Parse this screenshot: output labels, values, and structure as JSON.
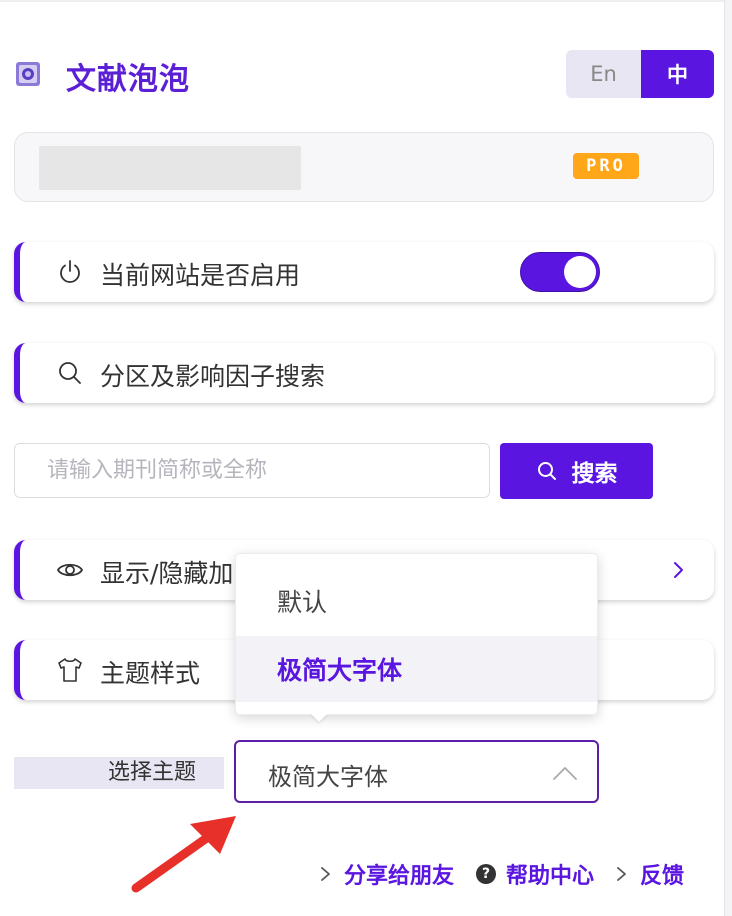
{
  "header": {
    "brand": "文献泡泡",
    "lang_en": "En",
    "lang_zh": "中"
  },
  "account": {
    "badge": "PRO"
  },
  "cards": {
    "site_toggle_label": "当前网站是否启用",
    "site_toggle_on": true,
    "search_section_label": "分区及影响因子搜索",
    "show_hide_label": "显示/隐藏加",
    "theme_style_label": "主题样式"
  },
  "search": {
    "placeholder": "请输入期刊简称或全称",
    "button_label": "搜索"
  },
  "theme_dropdown": {
    "options": [
      "默认",
      "极简大字体"
    ],
    "selected_index": 1
  },
  "theme_select": {
    "label": "选择主题",
    "value": "极简大字体"
  },
  "footer": {
    "share": "分享给朋友",
    "help": "帮助中心",
    "feedback": "反馈"
  },
  "colors": {
    "accent": "#5a16e0",
    "pro_badge": "#ffa619",
    "arrow": "#e8302a"
  },
  "icons": {
    "logo": "bubble-logo-icon",
    "power": "power-icon",
    "search": "search-icon",
    "eye": "eye-icon",
    "tshirt": "tshirt-icon",
    "chevron_right": "chevron-right-icon",
    "chevron_up": "chevron-up-icon",
    "help": "question-circle-icon"
  }
}
